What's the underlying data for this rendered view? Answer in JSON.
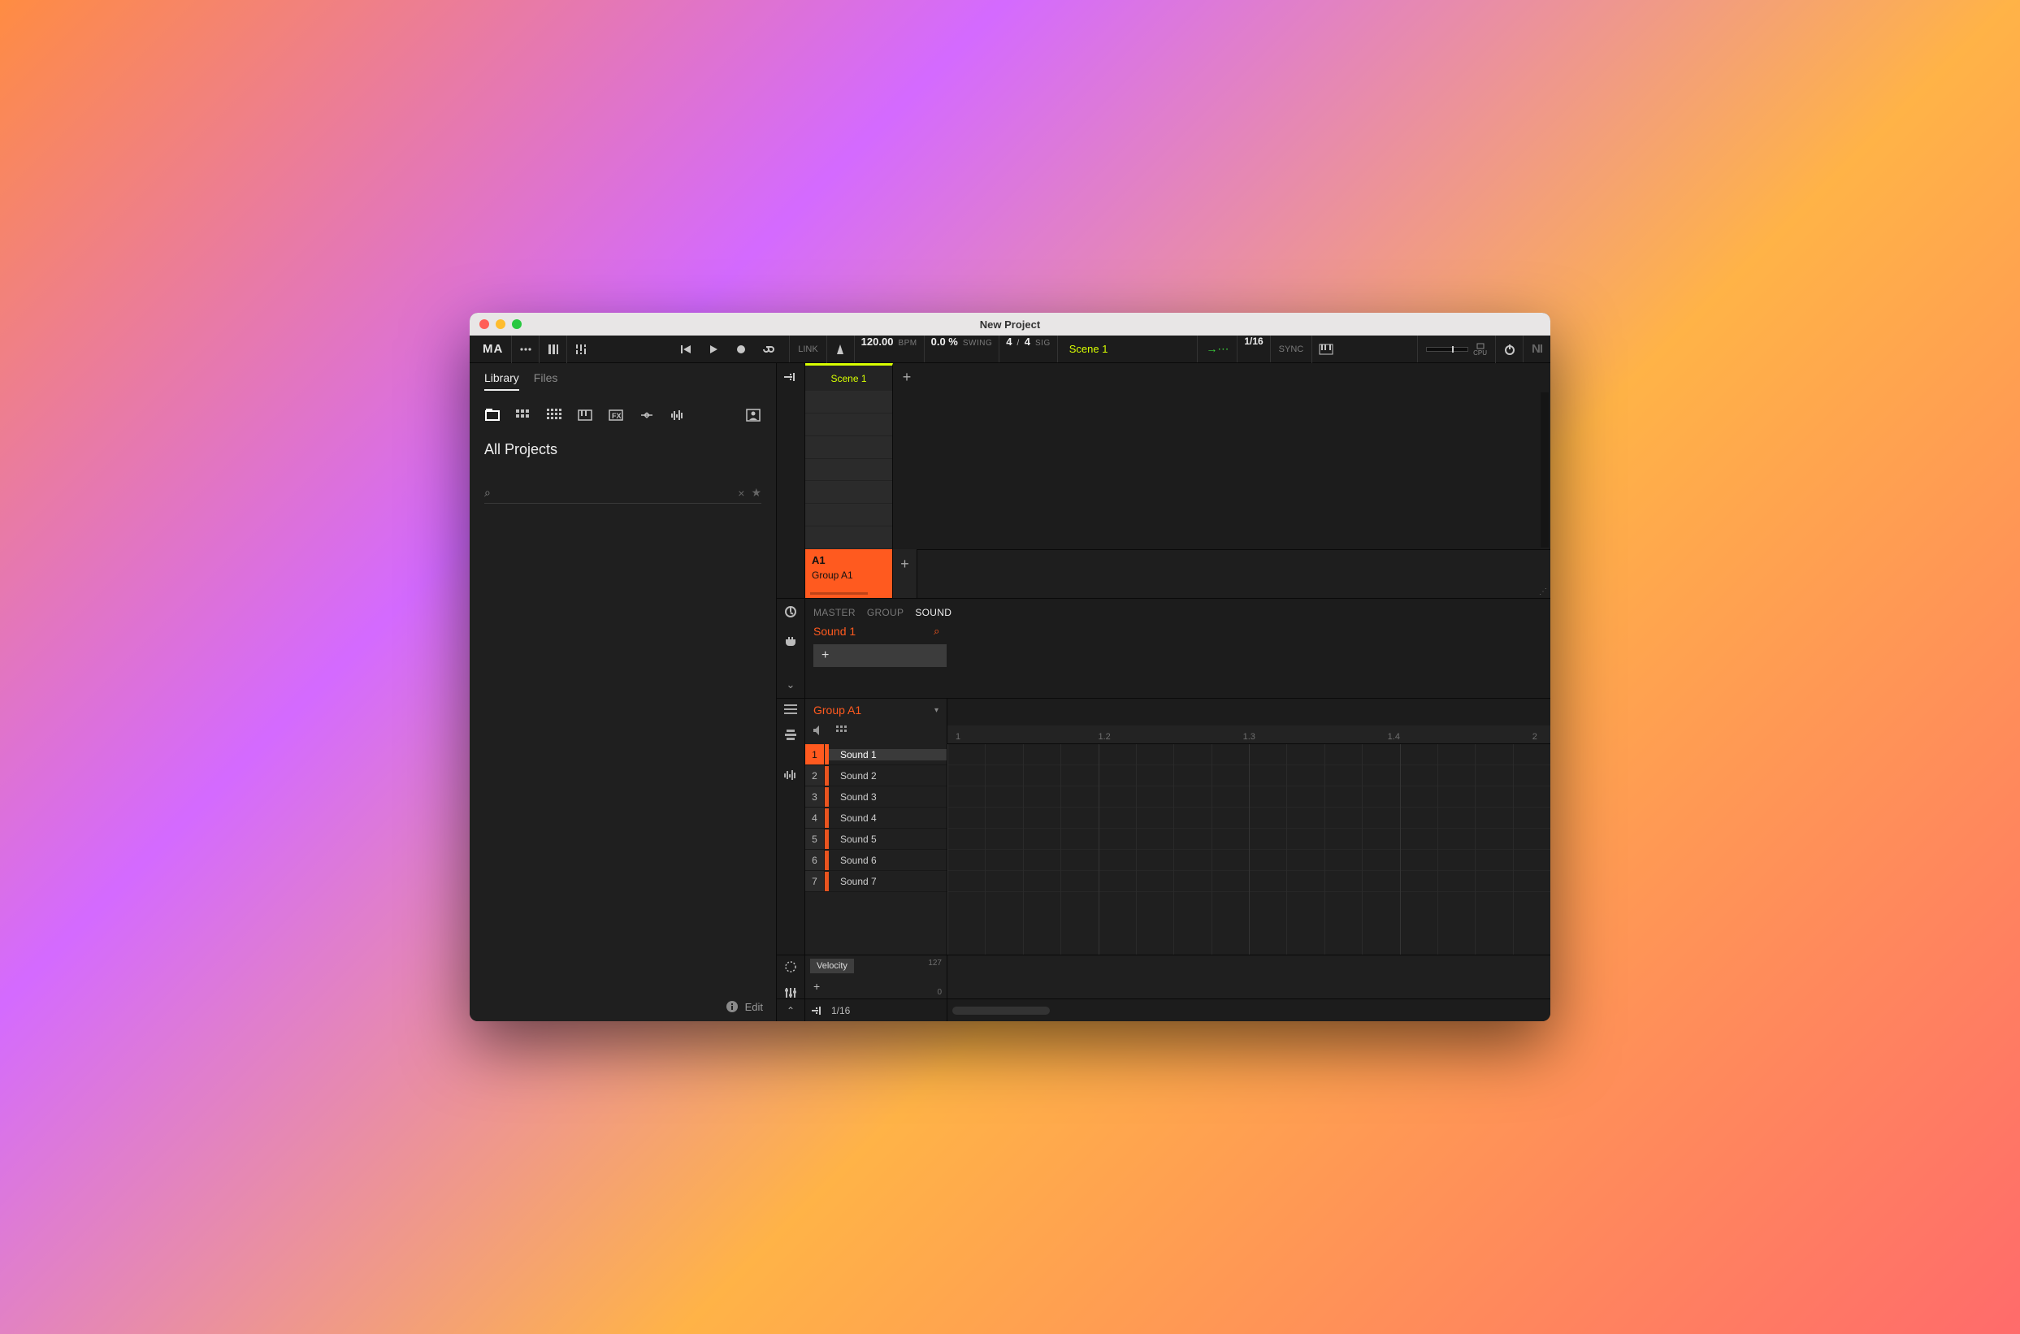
{
  "window": {
    "title": "New Project"
  },
  "toolbar": {
    "logo": "MA",
    "link": "LINK",
    "tempo": "120.00",
    "bpm_label": "BPM",
    "swing": "0.0 %",
    "swing_label": "SWING",
    "sig_num": "4",
    "sig_sep": "/",
    "sig_den": "4",
    "sig_label": "SIG",
    "scene": "Scene 1",
    "grid": "1/16",
    "sync": "SYNC",
    "cpu_label": "CPU",
    "ni": "NI"
  },
  "browser": {
    "tabs": {
      "library": "Library",
      "files": "Files"
    },
    "header": "All Projects",
    "search_placeholder": "",
    "clear": "×",
    "edit": "Edit"
  },
  "arranger": {
    "scene1": "Scene 1",
    "group": {
      "id": "A1",
      "name": "Group A1"
    }
  },
  "plugin": {
    "tabs": {
      "master": "MASTER",
      "group": "GROUP",
      "sound": "SOUND"
    },
    "sound_name": "Sound 1",
    "add": "+"
  },
  "editor": {
    "group_name": "Group A1",
    "ruler": {
      "t1": "1",
      "t12": "1.2",
      "t13": "1.3",
      "t14": "1.4",
      "t2": "2"
    },
    "sounds": [
      {
        "idx": "1",
        "name": "Sound 1",
        "sel": true
      },
      {
        "idx": "2",
        "name": "Sound 2",
        "sel": false
      },
      {
        "idx": "3",
        "name": "Sound 3",
        "sel": false
      },
      {
        "idx": "4",
        "name": "Sound 4",
        "sel": false
      },
      {
        "idx": "5",
        "name": "Sound 5",
        "sel": false
      },
      {
        "idx": "6",
        "name": "Sound 6",
        "sel": false
      },
      {
        "idx": "7",
        "name": "Sound 7",
        "sel": false
      }
    ],
    "velocity": {
      "label": "Velocity",
      "max": "127",
      "min": "0",
      "add": "+"
    },
    "footer_grid": "1/16"
  }
}
